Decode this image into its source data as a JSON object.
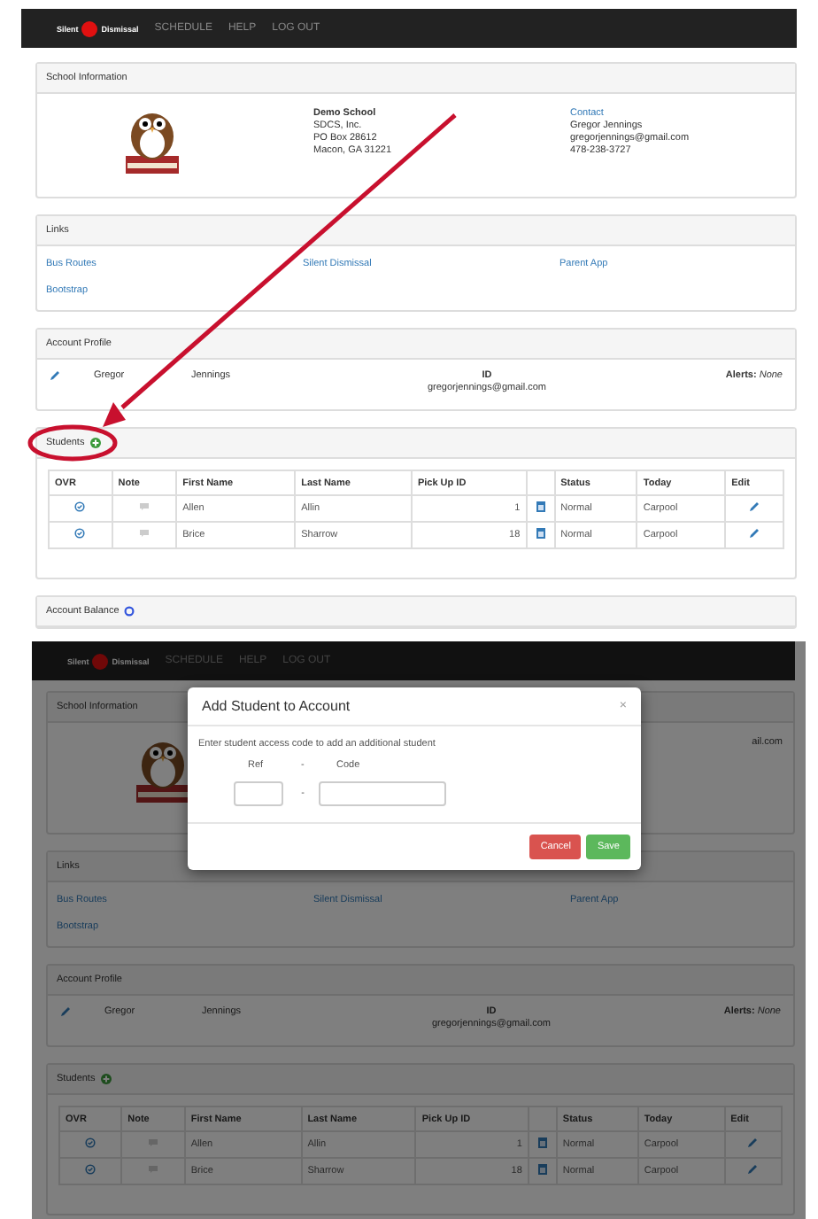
{
  "screens": [
    {
      "kind": "page",
      "annotated": true,
      "nav": {
        "logo_left": "Silent",
        "logo_right": "Dismissal",
        "items": [
          "SCHEDULE",
          "HELP",
          "LOG OUT"
        ]
      },
      "school": {
        "title": "School Information",
        "name": "Demo School",
        "address": [
          "SDCS, Inc.",
          "PO Box 28612",
          "Macon, GA 31221"
        ],
        "contact_link": "Contact",
        "contact": [
          "Gregor Jennings",
          "gregorjennings@gmail.com",
          "478-238-3727"
        ]
      },
      "links": {
        "title": "Links",
        "items": [
          "Bus Routes",
          "Silent Dismissal",
          "Parent App",
          "Bootstrap"
        ]
      },
      "profile": {
        "title": "Account Profile",
        "first": "Gregor",
        "last": "Jennings",
        "id_label": "ID",
        "email": "gregorjennings@gmail.com",
        "alerts": "**Alerts:** *None*"
      },
      "students": {
        "title": "Students",
        "columns": [
          {
            "kind": "text",
            "label": "OVR"
          },
          {
            "kind": "text",
            "label": "Note"
          },
          {
            "kind": "text",
            "label": "First Name"
          },
          {
            "kind": "text",
            "label": "Last Name"
          },
          {
            "kind": "text",
            "label": "Pick Up ID"
          },
          {
            "kind": "blank"
          },
          {
            "kind": "text",
            "label": "Status"
          },
          {
            "kind": "text",
            "label": "Today"
          },
          {
            "kind": "text",
            "label": "Edit"
          }
        ],
        "rows": [
          {
            "first": "Allen",
            "last": "Allin",
            "pickup_id": "1",
            "status": "Normal",
            "today": "Carpool"
          },
          {
            "first": "Brice",
            "last": "Sharrow",
            "pickup_id": "18",
            "status": "Normal",
            "today": "Carpool"
          }
        ]
      },
      "balance": {
        "title": "Account Balance"
      }
    },
    {
      "kind": "dimmed",
      "nav": {
        "logo_left": "Silent",
        "logo_right": "Dismissal",
        "items": [
          "SCHEDULE",
          "HELP",
          "LOG OUT"
        ]
      },
      "school": {
        "title": "School Information",
        "contact": [
          "ail.com"
        ]
      },
      "links": {
        "title": "Links",
        "items": [
          "Bus Routes",
          "Silent Dismissal",
          "Parent App",
          "Bootstrap"
        ]
      },
      "profile": {
        "title": "Account Profile",
        "first": "Gregor",
        "last": "Jennings",
        "id_label": "ID",
        "email": "gregorjennings@gmail.com",
        "alerts": "**Alerts:** *None*"
      },
      "students": {
        "title": "Students",
        "columns": [
          {
            "kind": "text",
            "label": "OVR"
          },
          {
            "kind": "text",
            "label": "Note"
          },
          {
            "kind": "text",
            "label": "First Name"
          },
          {
            "kind": "text",
            "label": "Last Name"
          },
          {
            "kind": "text",
            "label": "Pick Up ID"
          },
          {
            "kind": "blank"
          },
          {
            "kind": "text",
            "label": "Status"
          },
          {
            "kind": "text",
            "label": "Today"
          },
          {
            "kind": "text",
            "label": "Edit"
          }
        ],
        "rows": [
          {
            "first": "Allen",
            "last": "Allin",
            "pickup_id": "1",
            "status": "Normal",
            "today": "Carpool"
          },
          {
            "first": "Brice",
            "last": "Sharrow",
            "pickup_id": "18",
            "status": "Normal",
            "today": "Carpool"
          }
        ]
      },
      "modal": {
        "title": "Add Student to Account",
        "close": "×",
        "instructions": "Enter student access code to add an additional student",
        "ref_label": "Ref",
        "label_separator": "-",
        "code_label": "Code",
        "field_separator": "-",
        "buttons": [
          {
            "label": "Cancel",
            "kind": "danger"
          },
          {
            "label": "Save",
            "kind": "success"
          }
        ]
      }
    }
  ]
}
